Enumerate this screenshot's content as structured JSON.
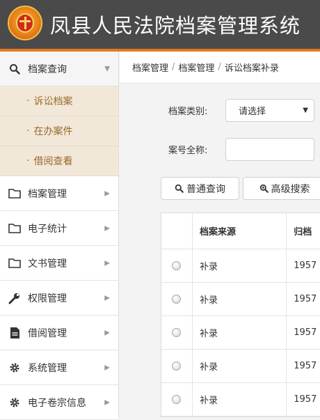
{
  "header": {
    "title": "凤县人民法院档案管理系统"
  },
  "sidebar": {
    "items": [
      {
        "label": "档案查询",
        "icon": "search-icon",
        "expanded": true,
        "children": [
          "诉讼档案",
          "在办案件",
          "借阅查看"
        ]
      },
      {
        "label": "档案管理",
        "icon": "folder-icon"
      },
      {
        "label": "电子统计",
        "icon": "folder-icon"
      },
      {
        "label": "文书管理",
        "icon": "folder-icon"
      },
      {
        "label": "权限管理",
        "icon": "wrench-icon"
      },
      {
        "label": "借阅管理",
        "icon": "document-icon"
      },
      {
        "label": "系统管理",
        "icon": "gear-icon"
      },
      {
        "label": "电子卷宗信息",
        "icon": "gear-icon"
      }
    ],
    "sub_bullet": "·"
  },
  "breadcrumb": {
    "items": [
      "档案管理",
      "档案管理",
      "诉讼档案补录"
    ],
    "separator": "/"
  },
  "form": {
    "category_label": "档案类别:",
    "category_value": "请选择",
    "case_label": "案号全称:",
    "case_value": ""
  },
  "buttons": {
    "normal_search": "普通查询",
    "advanced_search": "高级搜索"
  },
  "table": {
    "columns": [
      "",
      "档案来源",
      "归档"
    ],
    "rows": [
      {
        "source": "补录",
        "year": "1957"
      },
      {
        "source": "补录",
        "year": "1957"
      },
      {
        "source": "补录",
        "year": "1957"
      },
      {
        "source": "补录",
        "year": "1957"
      },
      {
        "source": "补录",
        "year": "1957"
      }
    ]
  },
  "colors": {
    "header_bg": "#4a4a4a",
    "accent": "#e07a1c",
    "submenu_bg": "#f2e8d9",
    "submenu_text": "#9a6a2c"
  }
}
